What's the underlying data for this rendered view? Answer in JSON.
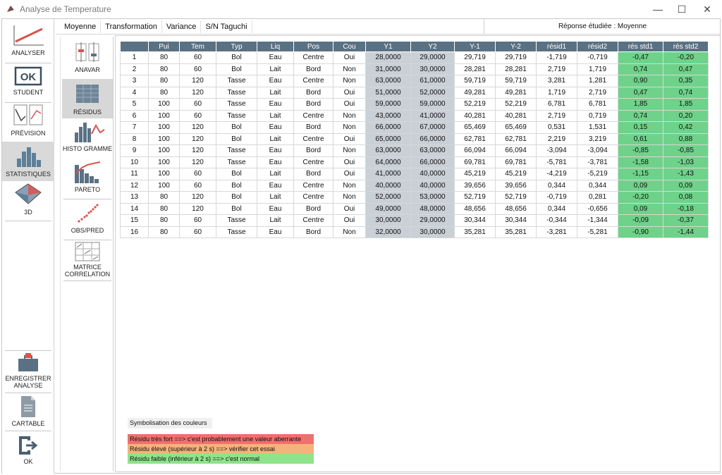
{
  "window": {
    "title": "Analyse de Temperature",
    "minimize": "—",
    "maximize": "☐",
    "close": "✕"
  },
  "menu": {
    "items": [
      "Moyenne",
      "Transformation",
      "Variance",
      "S/N Taguchi"
    ],
    "response": "Réponse étudiée : Moyenne"
  },
  "sidebar": {
    "items": [
      {
        "label": "ANALYSER",
        "icon": "analyser-chart-icon"
      },
      {
        "label": "STUDENT",
        "icon": "ok-box-icon"
      },
      {
        "label": "PRÉVISION",
        "icon": "prevision-chart-icon"
      },
      {
        "label": "STATISTIQUES",
        "icon": "statistics-bars-icon"
      },
      {
        "label": "3D",
        "icon": "3d-surface-icon"
      },
      {
        "label1": "ENREGISTRER",
        "label2": "ANALYSE",
        "icon": "save-briefcase-icon"
      },
      {
        "label": "CARTABLE",
        "icon": "document-icon"
      },
      {
        "label": "OK",
        "icon": "exit-icon"
      }
    ]
  },
  "subbar": {
    "items": [
      {
        "label": "ANAVAR"
      },
      {
        "label": "RÉSIDUS"
      },
      {
        "label": "HISTO GRAMME"
      },
      {
        "label": "PARETO"
      },
      {
        "label": "OBS/PRED"
      },
      {
        "label1": "MATRICE",
        "label2": "CORRELATION"
      }
    ]
  },
  "table": {
    "headers": [
      "",
      "Pui",
      "Tem",
      "Typ",
      "Liq",
      "Pos",
      "Cou",
      "Y1",
      "Y2",
      "Y-1",
      "Y-2",
      "résid1",
      "résid2",
      "rés std1",
      "rés std2"
    ],
    "rows": [
      [
        "1",
        "80",
        "60",
        "Bol",
        "Eau",
        "Centre",
        "Oui",
        "28,0000",
        "29,0000",
        "29,719",
        "29,719",
        "-1,719",
        "-0,719",
        "-0,47",
        "-0,20"
      ],
      [
        "2",
        "80",
        "60",
        "Bol",
        "Lait",
        "Bord",
        "Non",
        "31,0000",
        "30,0000",
        "28,281",
        "28,281",
        "2,719",
        "1,719",
        "0,74",
        "0,47"
      ],
      [
        "3",
        "80",
        "120",
        "Tasse",
        "Eau",
        "Centre",
        "Non",
        "63,0000",
        "61,0000",
        "59,719",
        "59,719",
        "3,281",
        "1,281",
        "0,90",
        "0,35"
      ],
      [
        "4",
        "80",
        "120",
        "Tasse",
        "Lait",
        "Bord",
        "Oui",
        "51,0000",
        "52,0000",
        "49,281",
        "49,281",
        "1,719",
        "2,719",
        "0,47",
        "0,74"
      ],
      [
        "5",
        "100",
        "60",
        "Tasse",
        "Eau",
        "Bord",
        "Oui",
        "59,0000",
        "59,0000",
        "52,219",
        "52,219",
        "6,781",
        "6,781",
        "1,85",
        "1,85"
      ],
      [
        "6",
        "100",
        "60",
        "Tasse",
        "Lait",
        "Centre",
        "Non",
        "43,0000",
        "41,0000",
        "40,281",
        "40,281",
        "2,719",
        "0,719",
        "0,74",
        "0,20"
      ],
      [
        "7",
        "100",
        "120",
        "Bol",
        "Eau",
        "Bord",
        "Non",
        "66,0000",
        "67,0000",
        "65,469",
        "65,469",
        "0,531",
        "1,531",
        "0,15",
        "0,42"
      ],
      [
        "8",
        "100",
        "120",
        "Bol",
        "Lait",
        "Centre",
        "Oui",
        "65,0000",
        "66,0000",
        "62,781",
        "62,781",
        "2,219",
        "3,219",
        "0,61",
        "0,88"
      ],
      [
        "9",
        "100",
        "120",
        "Tasse",
        "Eau",
        "Bord",
        "Non",
        "63,0000",
        "63,0000",
        "66,094",
        "66,094",
        "-3,094",
        "-3,094",
        "-0,85",
        "-0,85"
      ],
      [
        "10",
        "100",
        "120",
        "Tasse",
        "Eau",
        "Centre",
        "Oui",
        "64,0000",
        "66,0000",
        "69,781",
        "69,781",
        "-5,781",
        "-3,781",
        "-1,58",
        "-1,03"
      ],
      [
        "11",
        "100",
        "60",
        "Bol",
        "Lait",
        "Bord",
        "Oui",
        "41,0000",
        "40,0000",
        "45,219",
        "45,219",
        "-4,219",
        "-5,219",
        "-1,15",
        "-1,43"
      ],
      [
        "12",
        "100",
        "60",
        "Bol",
        "Eau",
        "Centre",
        "Non",
        "40,0000",
        "40,0000",
        "39,656",
        "39,656",
        "0,344",
        "0,344",
        "0,09",
        "0,09"
      ],
      [
        "13",
        "80",
        "120",
        "Bol",
        "Lait",
        "Centre",
        "Non",
        "52,0000",
        "53,0000",
        "52,719",
        "52,719",
        "-0,719",
        "0,281",
        "-0,20",
        "0,08"
      ],
      [
        "14",
        "80",
        "120",
        "Bol",
        "Eau",
        "Bord",
        "Oui",
        "49,0000",
        "48,0000",
        "48,656",
        "48,656",
        "0,344",
        "-0,656",
        "0,09",
        "-0,18"
      ],
      [
        "15",
        "80",
        "60",
        "Tasse",
        "Lait",
        "Centre",
        "Oui",
        "30,0000",
        "29,0000",
        "30,344",
        "30,344",
        "-0,344",
        "-1,344",
        "-0,09",
        "-0,37"
      ],
      [
        "16",
        "80",
        "60",
        "Tasse",
        "Eau",
        "Bord",
        "Non",
        "32,0000",
        "30,0000",
        "35,281",
        "35,281",
        "-3,281",
        "-5,281",
        "-0,90",
        "-1,44"
      ]
    ]
  },
  "legend": {
    "title": "Symbolisation des couleurs",
    "items": [
      {
        "text": "Résidu très fort ==> c'est probablement une valeur aberrante",
        "color": "#f06f6f"
      },
      {
        "text": "Résidu élevé (supérieur à 2 s) ==> vérifier cet essai",
        "color": "#f5b27a"
      },
      {
        "text": "Résidu faible (inférieur à 2 s) ==> c'est normal",
        "color": "#8fe38a"
      }
    ]
  },
  "colors": {
    "header_bg": "#5a7184",
    "y_col_bg": "#c9d0d6",
    "residual_ok_bg": "#6ed28a",
    "active_nav": "#d9d9d9"
  }
}
